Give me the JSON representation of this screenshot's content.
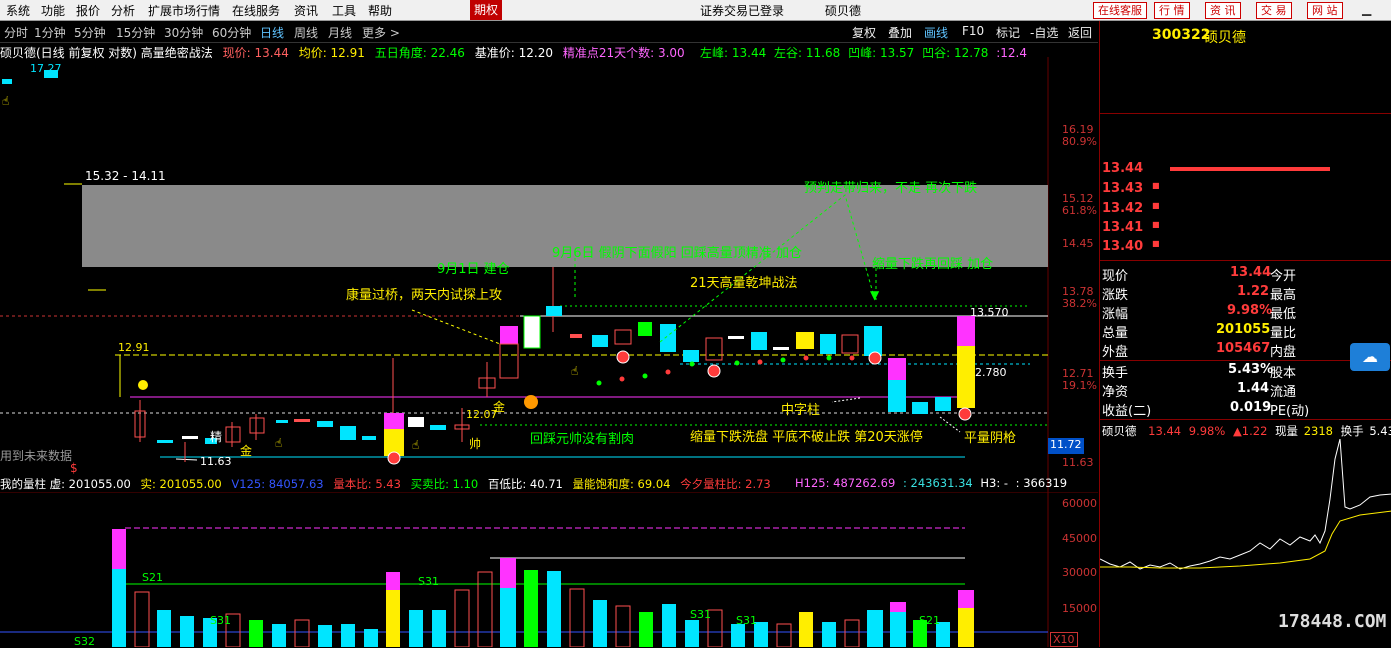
{
  "menubar": {
    "items": [
      "系统",
      "功能",
      "报价",
      "分析",
      "扩展市场行情",
      "在线服务",
      "资讯",
      "工具",
      "帮助"
    ],
    "mode_button": "期权",
    "status": "证券交易已登录",
    "stock_name": "硕贝德",
    "right_buttons": [
      "在线客服",
      "行 情",
      "资 讯",
      "交 易",
      "网 站"
    ]
  },
  "period_bar": {
    "periods": [
      "分时",
      "1分钟",
      "5分钟",
      "15分钟",
      "30分钟",
      "60分钟",
      "日线",
      "周线",
      "月线",
      "更多 >"
    ],
    "selected": "日线",
    "tools": [
      "复权",
      "叠加",
      "画线",
      "F10",
      "标记",
      "-自选",
      "返回"
    ]
  },
  "indicator_line": {
    "title": "硕贝德(日线 前复权 对数) 高量绝密战法",
    "items": [
      {
        "text": "现价: 13.44",
        "color": "#ff6060"
      },
      {
        "text": "均价: 12.91",
        "color": "#ffee00"
      },
      {
        "text": "五日角度: 22.46",
        "color": "#00ff00"
      },
      {
        "text": "基准价: 12.20",
        "color": "#ffffff"
      },
      {
        "text": "精准点21天个数: 3.00",
        "color": "#ff66ff"
      },
      {
        "text": "左峰: 13.44",
        "color": "#00ff00"
      },
      {
        "text": "左谷: 11.68",
        "color": "#00ff00"
      },
      {
        "text": "凹峰: 13.57",
        "color": "#00ff00"
      },
      {
        "text": "凹谷: 12.78",
        "color": "#00ff00"
      },
      {
        "text": ":12.4",
        "color": "#ff66ff"
      }
    ]
  },
  "price_axis": [
    "16.19",
    "80.9%",
    "15.12",
    "61.8%",
    "14.45",
    "13.78",
    "38.2%",
    "12.71",
    "19.1%",
    "11.72",
    "11.63"
  ],
  "annotations": {
    "range_label": "15.32 - 14.11",
    "jianc": "9月1日 建仓",
    "jiayang": "9月6日 假阴下面假阳 回踩高量顶精准 加仓",
    "kangliang": "康量过桥，两天内试探上攻",
    "qiankun": "21天高量乾坤战法",
    "yupan": "预判走带归来，不走 再次下跌",
    "suoliang_jiacang": "缩量下跌再回踩 加仓",
    "zhongzi": "中字柱",
    "huicai": "回踩元帅没有割肉",
    "suoliang_xidie": "缩量下跌洗盘 平底不破止跌 第20天涨停",
    "pingliang": "平量阴枪",
    "jin1": "金",
    "jin2": "金",
    "shuai": "帅",
    "jing": "精",
    "val_1291": "12.91",
    "val_1207": "12.07",
    "val_1163": "11.63",
    "val_13570": "13.570",
    "val_2780": "2.780",
    "val_1727": "17.27",
    "future": "用到未来数据",
    "dollar": "$"
  },
  "volume_header": {
    "items": [
      {
        "text": "我的量柱 虚: 201055.00",
        "color": "#ffffff"
      },
      {
        "text": "实: 201055.00",
        "color": "#ffee00"
      },
      {
        "text": "V125: 84057.63",
        "color": "#3355ff"
      },
      {
        "text": "量本比: 5.43",
        "color": "#ff3b3b"
      },
      {
        "text": "买卖比: 1.10",
        "color": "#00ff00"
      },
      {
        "text": "百低比: 40.71",
        "color": "#ffffff"
      },
      {
        "text": "量能饱和度: 69.04",
        "color": "#ffee00"
      },
      {
        "text": "今夕量柱比: 2.73",
        "color": "#ff3b3b"
      },
      {
        "text": "H125: 487262.69",
        "color": "#ff66ff"
      },
      {
        "text": ": 243631.34",
        "color": "#39e0e0"
      },
      {
        "text": "H3: -",
        "color": "#ffffff"
      },
      {
        "text": ": 366319",
        "color": "#ffffff"
      }
    ]
  },
  "volume_axis": [
    "60000",
    "45000",
    "30000",
    "15000",
    "X10"
  ],
  "volume_labels": [
    "S21",
    "S31",
    "S31",
    "S31",
    "S31",
    "S21",
    "S32"
  ],
  "right_panel": {
    "code": "300322",
    "name": "硕贝德",
    "order_book": [
      {
        "price": "13.44",
        "mark": "",
        "color": "#ff3b3b"
      },
      {
        "price": "13.43",
        "mark": "■",
        "color": "#ff3b3b"
      },
      {
        "price": "13.42",
        "mark": "■",
        "color": "#ff3b3b"
      },
      {
        "price": "13.41",
        "mark": "■",
        "color": "#ff3b3b"
      },
      {
        "price": "13.40",
        "mark": "■",
        "color": "#ff3b3b"
      }
    ],
    "quotes": [
      {
        "label": "现价",
        "value": "13.44",
        "label2": "今开"
      },
      {
        "label": "涨跌",
        "value": "1.22",
        "label2": "最高"
      },
      {
        "label": "涨幅",
        "value": "9.98%",
        "label2": "最低"
      },
      {
        "label": "总量",
        "value": "201055",
        "label2": "量比"
      },
      {
        "label": "外盘",
        "value": "105467",
        "label2": "内盘"
      },
      {
        "label": "换手",
        "value": "5.43%",
        "label2": "股本"
      },
      {
        "label": "净资",
        "value": "1.44",
        "label2": "流通"
      },
      {
        "label": "收益(二)",
        "value": "0.019",
        "label2": "PE(动)"
      }
    ],
    "mini_header": {
      "name": "硕贝德",
      "price": "13.44",
      "pct": "9.98%",
      "change": "▲1.22",
      "vol_label": "现量",
      "vol": "2318",
      "turn_label": "换手",
      "turn": "5.43%"
    },
    "watermark": "178448.COM"
  }
}
